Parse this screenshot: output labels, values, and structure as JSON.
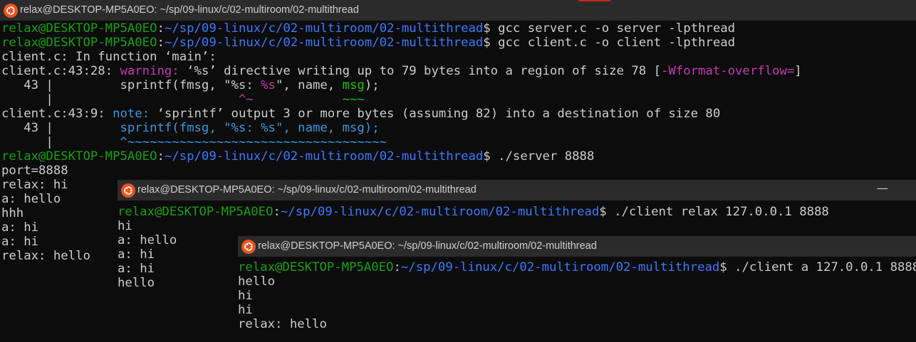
{
  "windows": [
    {
      "id": "server",
      "title": "relax@DESKTOP-MP5A0EO: ~/sp/09-linux/c/02-multiroom/02-multithread",
      "has_minimize": false,
      "lines": [
        [
          {
            "t": "relax@DESKTOP-MP5A0EO",
            "c": "g"
          },
          {
            "t": ":"
          },
          {
            "t": "~/sp/09-linux/c/02-multiroom/02-multithread",
            "c": "b"
          },
          {
            "t": "$ gcc server.c -o server -lpthread"
          }
        ],
        [
          {
            "t": "relax@DESKTOP-MP5A0EO",
            "c": "g"
          },
          {
            "t": ":"
          },
          {
            "t": "~/sp/09-linux/c/02-multiroom/02-multithread",
            "c": "b"
          },
          {
            "t": "$ gcc client.c -o client -lpthread"
          }
        ],
        [
          {
            "t": "client.c: In function ‘main’:"
          }
        ],
        [
          {
            "t": "client.c:43:28: "
          },
          {
            "t": "warning: ",
            "c": "m"
          },
          {
            "t": "‘%s’ directive writing up to 79 bytes into a region of size 78 ["
          },
          {
            "t": "-Wformat-overflow=",
            "c": "m"
          },
          {
            "t": "]"
          }
        ],
        [
          {
            "t": "   43 |         sprintf(fmsg, \"%s: "
          },
          {
            "t": "%s",
            "c": "m"
          },
          {
            "t": "\", name, "
          },
          {
            "t": "msg",
            "c": "gg"
          },
          {
            "t": ");"
          }
        ],
        [
          {
            "t": "      |                         "
          },
          {
            "t": "^~",
            "c": "m"
          },
          {
            "t": "            "
          },
          {
            "t": "~~~",
            "c": "gg"
          }
        ],
        [
          {
            "t": "client.c:43:9: "
          },
          {
            "t": "note: ",
            "c": "c"
          },
          {
            "t": "‘sprintf’ output 3 or more bytes (assuming 82) into a destination of size 80"
          }
        ],
        [
          {
            "t": "   43 |         "
          },
          {
            "t": "sprintf(fmsg, \"%s: %s\", name, msg);",
            "c": "c"
          }
        ],
        [
          {
            "t": "      |         "
          },
          {
            "t": "^~~~~~~~~~~~~~~~~~~~~~~~~~~~~~~~~~~~",
            "c": "c"
          }
        ],
        [
          {
            "t": "relax@DESKTOP-MP5A0EO",
            "c": "g"
          },
          {
            "t": ":"
          },
          {
            "t": "~/sp/09-linux/c/02-multiroom/02-multithread",
            "c": "b"
          },
          {
            "t": "$ ./server 8888"
          }
        ],
        [
          {
            "t": "port=8888"
          }
        ],
        [
          {
            "t": "relax: hi"
          }
        ],
        [
          {
            "t": "a: hello"
          }
        ],
        [
          {
            "t": "hhh"
          }
        ],
        [
          {
            "t": "a: hi"
          }
        ],
        [
          {
            "t": "a: hi"
          }
        ],
        [
          {
            "t": "relax: hello"
          }
        ]
      ]
    },
    {
      "id": "client-relax",
      "title": "relax@DESKTOP-MP5A0EO: ~/sp/09-linux/c/02-multiroom/02-multithread",
      "has_minimize": true,
      "minimize_glyph": "—",
      "lines": [
        [
          {
            "t": "relax@DESKTOP-MP5A0EO",
            "c": "g"
          },
          {
            "t": ":"
          },
          {
            "t": "~/sp/09-linux/c/02-multiroom/02-multithread",
            "c": "b"
          },
          {
            "t": "$ ./client relax 127.0.0.1 8888"
          }
        ],
        [
          {
            "t": "hi"
          }
        ],
        [
          {
            "t": "a: hello"
          }
        ],
        [
          {
            "t": "a: hi"
          }
        ],
        [
          {
            "t": "a: hi"
          }
        ],
        [
          {
            "t": "hello"
          }
        ]
      ]
    },
    {
      "id": "client-a",
      "title": "relax@DESKTOP-MP5A0EO: ~/sp/09-linux/c/02-multiroom/02-multithread",
      "has_minimize": false,
      "lines": [
        [
          {
            "t": "relax@DESKTOP-MP5A0EO",
            "c": "g"
          },
          {
            "t": ":"
          },
          {
            "t": "~/sp/09-linux/c/02-multiroom/02-multithread",
            "c": "b"
          },
          {
            "t": "$ ./client a 127.0.0.1 8888"
          }
        ],
        [
          {
            "t": "hello"
          }
        ],
        [
          {
            "t": "hi"
          }
        ],
        [
          {
            "t": "hi"
          }
        ],
        [
          {
            "t": "relax: hello"
          }
        ]
      ]
    }
  ],
  "colors": {
    "terminal_bg": "#0c0c0c",
    "titlebar_bg": "#2b2b2b",
    "ubuntu_orange": "#e95420",
    "prompt_user": "#13a10e",
    "prompt_path": "#3b78ff",
    "warning": "#c239b3",
    "note": "#3a96dd"
  },
  "icons": [
    "ubuntu-icon",
    "minimize-icon"
  ]
}
